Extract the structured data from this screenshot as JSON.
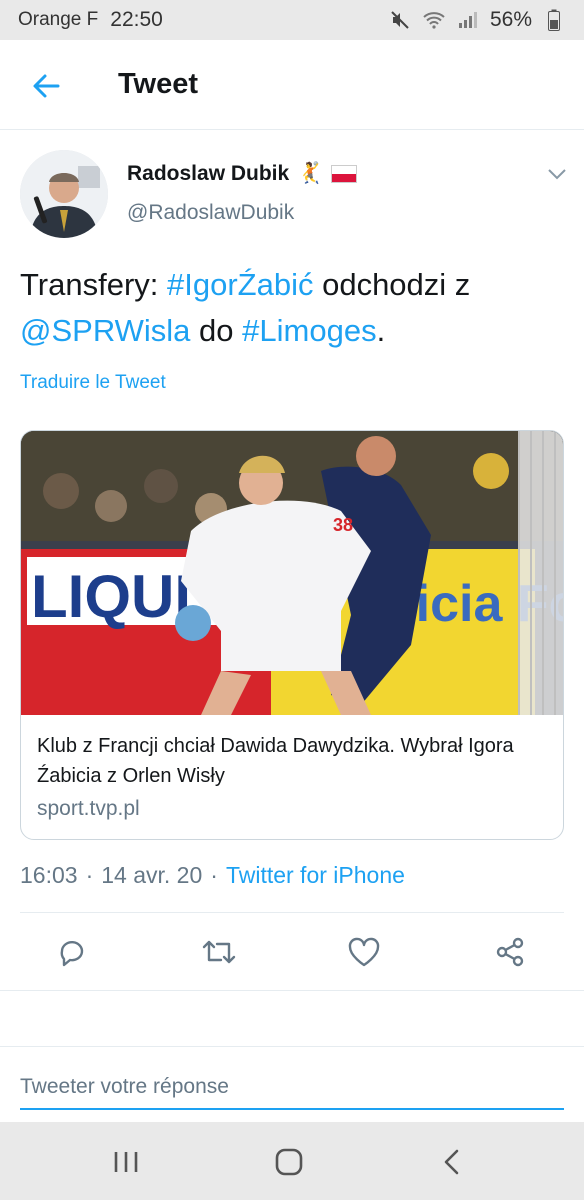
{
  "status_bar": {
    "carrier": "Orange F",
    "time": "22:50",
    "battery": "56%",
    "icons": [
      "mute-icon",
      "wifi-icon",
      "signal-icon",
      "battery-icon"
    ]
  },
  "header": {
    "back_icon": "arrow-left-icon",
    "title": "Tweet"
  },
  "tweet": {
    "author_name": "Radoslaw Dubik",
    "author_emoji": "🤾",
    "author_handle": "@RadoslawDubik",
    "text_parts": {
      "p1": "Transfery: ",
      "hashtag1": "#IgorŹabić",
      "p2": " odchodzi z ",
      "mention": "@SPRWisla",
      "p3": " do ",
      "hashtag2": "#Limoges",
      "p4": "."
    },
    "translate_label": "Traduire le Tweet",
    "card": {
      "title": "Klub z Francji chciał Dawida Dawydzika. Wybrał Igora Źabicia z Orlen Wisły",
      "domain": "sport.tvp.pl",
      "image_banner_left": "LIQUI MOLI",
      "image_banner_right": "fficia Food",
      "jersey_number": "38"
    },
    "time": "16:03",
    "date": "14 avr. 20",
    "separator": "·",
    "source": "Twitter for iPhone"
  },
  "actions": [
    "reply-icon",
    "retweet-icon",
    "like-icon",
    "share-icon"
  ],
  "reply": {
    "placeholder": "Tweeter votre réponse"
  },
  "nav": [
    "recents-icon",
    "home-icon",
    "back-icon"
  ],
  "colors": {
    "accent": "#1da1f2",
    "secondary_text": "#657786",
    "border": "#e6ecf0"
  }
}
